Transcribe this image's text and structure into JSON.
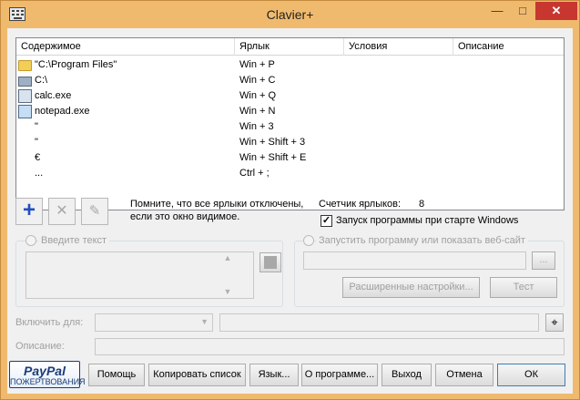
{
  "window": {
    "title": "Clavier+"
  },
  "titlebar": {
    "minimize": "—",
    "maximize": "□",
    "close": "✕"
  },
  "list": {
    "columns": [
      "Содержимое",
      "Ярлык",
      "Условия",
      "Описание"
    ],
    "rows": [
      {
        "icon": "folder-icon",
        "content": "\"C:\\Program Files\"",
        "shortcut": "Win + P"
      },
      {
        "icon": "drive-icon",
        "content": "C:\\",
        "shortcut": "Win + C"
      },
      {
        "icon": "calculator-icon",
        "content": "calc.exe",
        "shortcut": "Win + Q"
      },
      {
        "icon": "notepad-icon",
        "content": "notepad.exe",
        "shortcut": "Win + N"
      },
      {
        "icon": "",
        "content": "\"",
        "shortcut": "Win + 3"
      },
      {
        "icon": "",
        "content": "\"",
        "shortcut": "Win + Shift + 3"
      },
      {
        "icon": "",
        "content": "€",
        "shortcut": "Win + Shift + E"
      },
      {
        "icon": "",
        "content": "...",
        "shortcut": "Ctrl + ;"
      }
    ]
  },
  "toolbar": {
    "add_icon": "plus-icon",
    "delete_icon": "delete-icon",
    "edit_icon": "pencil-icon"
  },
  "info": {
    "note_line1": "Помните, что все ярлыки отключены,",
    "note_line2": "если это окно видимое.",
    "counter_label": "Счетчик ярлыков:",
    "counter_value": "8",
    "startup_label": "Запуск программы при старте Windows",
    "startup_checked": true
  },
  "text_group": {
    "label": "Введите текст"
  },
  "program_group": {
    "label": "Запустить программу или показать веб-сайт",
    "browse_label": "...",
    "advanced_label": "Расширенные настройки...",
    "test_label": "Тест"
  },
  "enable_for": {
    "label": "Включить для:"
  },
  "description": {
    "label": "Описание:"
  },
  "paypal": {
    "brand": "PayPal",
    "caption": "ПОЖЕРТВОВАНИЯ"
  },
  "buttons": {
    "help": "Помощь",
    "copy_list": "Копировать список",
    "language": "Язык...",
    "about": "О программе...",
    "exit": "Выход",
    "cancel": "Отмена",
    "ok": "ОК"
  }
}
